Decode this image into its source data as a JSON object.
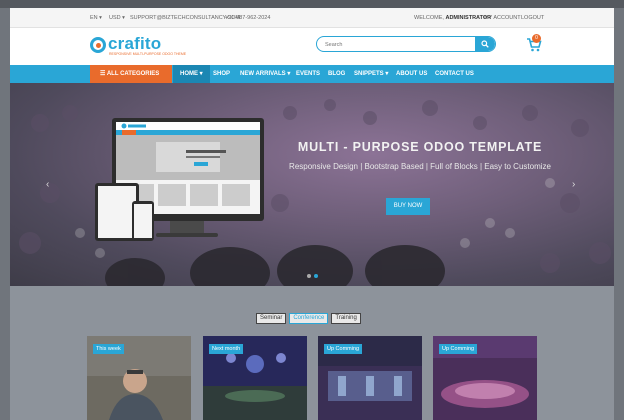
{
  "topbar": {
    "language": "EN",
    "currency": "USD",
    "email": "SUPPORT@BIZTECHCONSULTANCY.COM",
    "phone": "+91-487-962-2024",
    "welcome_prefix": "WELCOME,",
    "welcome_user": "ADMINISTRATOR",
    "my_account": "MY ACCOUNT",
    "logout": "LOGOUT"
  },
  "header": {
    "logo_text": "crafito",
    "logo_tagline": "RESPONSIVE MULTI-PURPOSE ODOO THEME",
    "search_placeholder": "Search",
    "cart_count": "0"
  },
  "nav": {
    "all_categories": "ALL CATEGORIES",
    "items": [
      {
        "label": "HOME",
        "dropdown": true,
        "active": true
      },
      {
        "label": "SHOP",
        "dropdown": false
      },
      {
        "label": "NEW ARRIVALS",
        "dropdown": true
      },
      {
        "label": "EVENTS",
        "dropdown": false
      },
      {
        "label": "BLOG",
        "dropdown": false
      },
      {
        "label": "SNIPPETS",
        "dropdown": true
      },
      {
        "label": "ABOUT US",
        "dropdown": false
      },
      {
        "label": "CONTACT US",
        "dropdown": false
      }
    ]
  },
  "hero": {
    "title": "MULTI - PURPOSE ODOO TEMPLATE",
    "subtitle": "Responsive Design | Bootstrap Based | Full of Blocks | Easy to Customize",
    "button": "BUY NOW",
    "prev_arrow": "‹",
    "next_arrow": "›",
    "slides": 2,
    "active_slide": 1
  },
  "events": {
    "filters": [
      "Seminar",
      "Conference",
      "Training"
    ],
    "active_filter": "Conference",
    "cards": [
      {
        "badge": "This week"
      },
      {
        "badge": "Next month"
      },
      {
        "badge": "Up Comming"
      },
      {
        "badge": "Up Comming"
      }
    ]
  },
  "colors": {
    "accent": "#2aa6d6",
    "accent_dark": "#1b87b3",
    "orange": "#e96b2c",
    "overlay": "#6f747b"
  }
}
